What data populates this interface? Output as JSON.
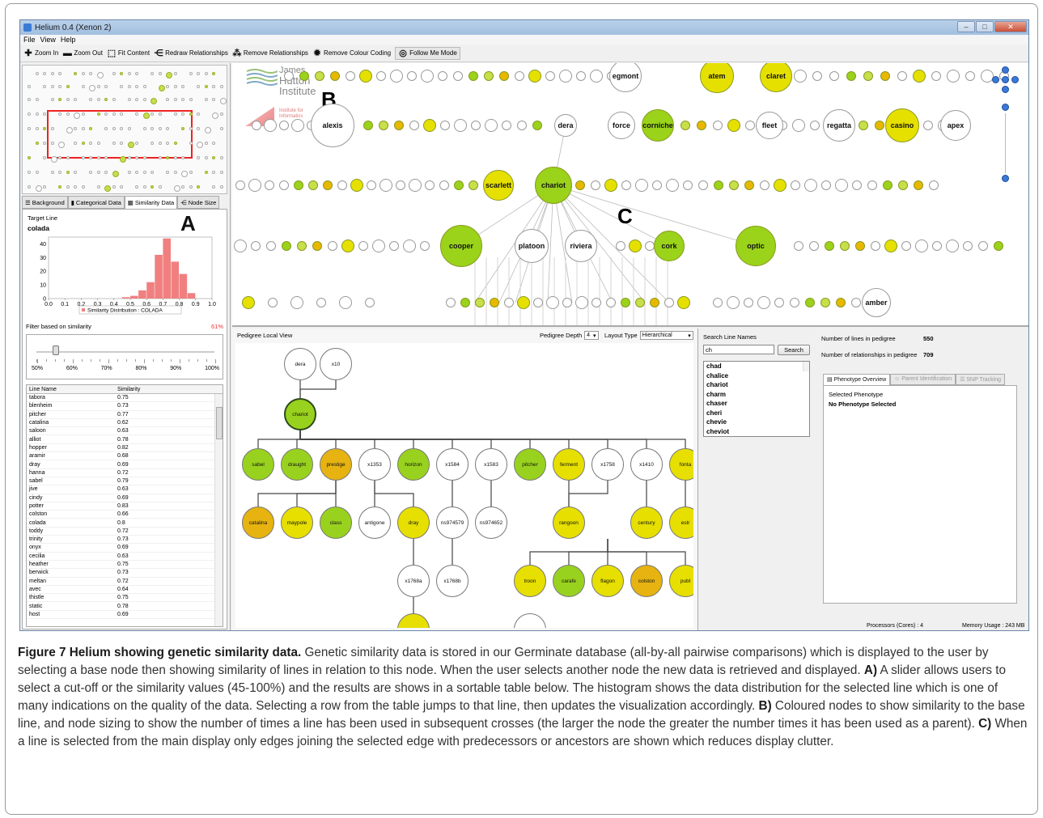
{
  "window": {
    "title": "Helium 0.4 (Xenon 2)",
    "menu": [
      "File",
      "View",
      "Help"
    ]
  },
  "toolbar": {
    "zoom_in": "Zoom In",
    "zoom_out": "Zoom Out",
    "fit_content": "Fit Content",
    "redraw": "Redraw Relationships",
    "remove_rel": "Remove Relationships",
    "remove_colour": "Remove Colour Coding",
    "follow_me": "Follow Me Mode"
  },
  "left_tabs": [
    "Background",
    "Categorical Data",
    "Similarity Data",
    "Node Size"
  ],
  "similarity": {
    "target_label": "Target Line",
    "target_name": "colada",
    "panel_letter": "A",
    "filter_label": "Filter based on similarity",
    "filter_value": "61%",
    "slider_fraction": 0.11,
    "slider_labels": [
      "50%",
      "60%",
      "70%",
      "80%",
      "90%",
      "100%"
    ],
    "table_headers": [
      "Line Name",
      "Similarity"
    ],
    "rows": [
      [
        "tabora",
        "0.75"
      ],
      [
        "blenheim",
        "0.73"
      ],
      [
        "pitcher",
        "0.77"
      ],
      [
        "catalina",
        "0.62"
      ],
      [
        "saloon",
        "0.63"
      ],
      [
        "alliot",
        "0.78"
      ],
      [
        "hopper",
        "0.82"
      ],
      [
        "aramir",
        "0.68"
      ],
      [
        "dray",
        "0.69"
      ],
      [
        "hanna",
        "0.72"
      ],
      [
        "sabel",
        "0.79"
      ],
      [
        "jive",
        "0.63"
      ],
      [
        "cindy",
        "0.69"
      ],
      [
        "potter",
        "0.83"
      ],
      [
        "colston",
        "0.66"
      ],
      [
        "colada",
        "0.8"
      ],
      [
        "toddy",
        "0.72"
      ],
      [
        "trinity",
        "0.73"
      ],
      [
        "onyx",
        "0.69"
      ],
      [
        "cecilia",
        "0.63"
      ],
      [
        "heather",
        "0.75"
      ],
      [
        "berwick",
        "0.73"
      ],
      [
        "meltan",
        "0.72"
      ],
      [
        "avec",
        "0.64"
      ],
      [
        "thistle",
        "0.75"
      ],
      [
        "static",
        "0.78"
      ],
      [
        "host",
        "0.69"
      ]
    ]
  },
  "chart_data": {
    "type": "bar",
    "categories": [
      "0.45",
      "0.5",
      "0.55",
      "0.6",
      "0.65",
      "0.7",
      "0.75",
      "0.8",
      "0.85"
    ],
    "values": [
      1,
      2,
      6,
      12,
      32,
      44,
      27,
      18,
      4
    ],
    "x_ticks": [
      "0.0",
      "0.1",
      "0.2",
      "0.3",
      "0.4",
      "0.5",
      "0.6",
      "0.7",
      "0.8",
      "0.9",
      "1.0"
    ],
    "y_ticks": [
      "0",
      "10",
      "20",
      "30",
      "40"
    ],
    "xlim": [
      0,
      1
    ],
    "ylim": [
      0,
      45
    ],
    "legend": "Similarity Distribution : COLADA",
    "bar_color": "#f08080"
  },
  "main_view": {
    "letter_b": "B",
    "letter_c": "C",
    "logo_lines": [
      "James",
      "Hutton",
      "Institute"
    ],
    "logo2_lines": [
      "Institute for",
      "Informatics"
    ],
    "named_nodes": [
      "egmont",
      "atem",
      "claret",
      "alexis",
      "dera",
      "force",
      "corniche",
      "fleet",
      "regatta",
      "casino",
      "apex",
      "scarlett",
      "chariot",
      "cooper",
      "platoon",
      "riviera",
      "cork",
      "optic",
      "amber"
    ]
  },
  "pedigree": {
    "title": "Pedigree Local View",
    "depth_label": "Pedigree Depth",
    "depth_value": "4",
    "layout_label": "Layout Type",
    "layout_value": "Hierarchical",
    "nodes": [
      "dera",
      "x10",
      "chariot",
      "sabel",
      "draught",
      "prestige",
      "x1353",
      "horizon",
      "x1584",
      "x1583",
      "pitcher",
      "ferment",
      "x1758",
      "x1410",
      "fonta",
      "catalina",
      "maypole",
      "class",
      "antigone",
      "dray",
      "ns974579",
      "ns974652",
      "rangoon",
      "century",
      "estr",
      "x1768a",
      "x1768b",
      "troon",
      "carafe",
      "flagon",
      "colston",
      "publ"
    ]
  },
  "side": {
    "search_label": "Search Line Names",
    "search_value": "ch",
    "search_button": "Search",
    "results": [
      "chad",
      "chalice",
      "chariot",
      "charm",
      "chaser",
      "cheri",
      "chevie",
      "cheviot"
    ],
    "lines_label": "Number of lines in pedigree",
    "lines_value": "550",
    "rel_label": "Number of relationships in pedigree",
    "rel_value": "709",
    "tabs": [
      "Phenotype Overview",
      "Parent Identification",
      "SNP Tracking"
    ],
    "selected_label": "Selected Phenotype",
    "selected_value": "No Phenotype Selected",
    "processors": "Processors (Cores) :  4",
    "memory": "Memory Usage :  243 MB"
  },
  "caption": {
    "title": "Figure 7 Helium showing genetic similarity data.",
    "body": " Genetic similarity data is stored in our Germinate database (all-by-all pairwise comparisons) which is displayed to the user by selecting a base node then showing similarity of lines in relation to this node. When the user selects another node the new data is retrieved and displayed. ",
    "a_label": "A)",
    "a_text": " A slider allows users to select a cut-off or the similarity values (45-100%) and the results are shows in a sortable table below. The histogram shows the data distribution for the selected line which is one of many indications on the quality of the data. Selecting a row from the table jumps to that line, then updates the visualization accordingly. ",
    "b_label": "B)",
    "b_text": " Coloured nodes to show similarity to the base line, and node sizing to show the number of times a line has been used in subsequent crosses (the larger the node the greater the number times it has been used as a parent). ",
    "c_label": "C)",
    "c_text": " When a line is selected from the main display only edges joining the selected edge with predecessors or ancestors are shown which reduces display clutter."
  }
}
